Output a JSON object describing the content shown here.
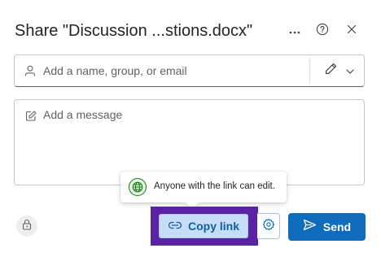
{
  "dialog": {
    "title": "Share \"Discussion ...stions.docx\""
  },
  "header": {
    "more_icon": "more-horizontal-icon",
    "help_icon": "help-circle-icon",
    "close_icon": "close-icon"
  },
  "people": {
    "placeholder": "Add a name, group, or email",
    "value": "",
    "permission_icon": "pencil-icon"
  },
  "message": {
    "placeholder": "Add a message",
    "value": ""
  },
  "tooltip": {
    "text": "Anyone with the link can edit.",
    "icon": "globe-icon"
  },
  "footer": {
    "lock_icon": "lock-icon",
    "copy_link_label": "Copy link",
    "copy_link_icon": "link-icon",
    "settings_icon": "gear-icon",
    "send_label": "Send",
    "send_icon": "send-icon"
  },
  "colors": {
    "primary": "#0f6cbd",
    "copy_link_bg": "#c7dcf5",
    "highlight": "#5c22a6",
    "globe_green": "#107c10"
  }
}
